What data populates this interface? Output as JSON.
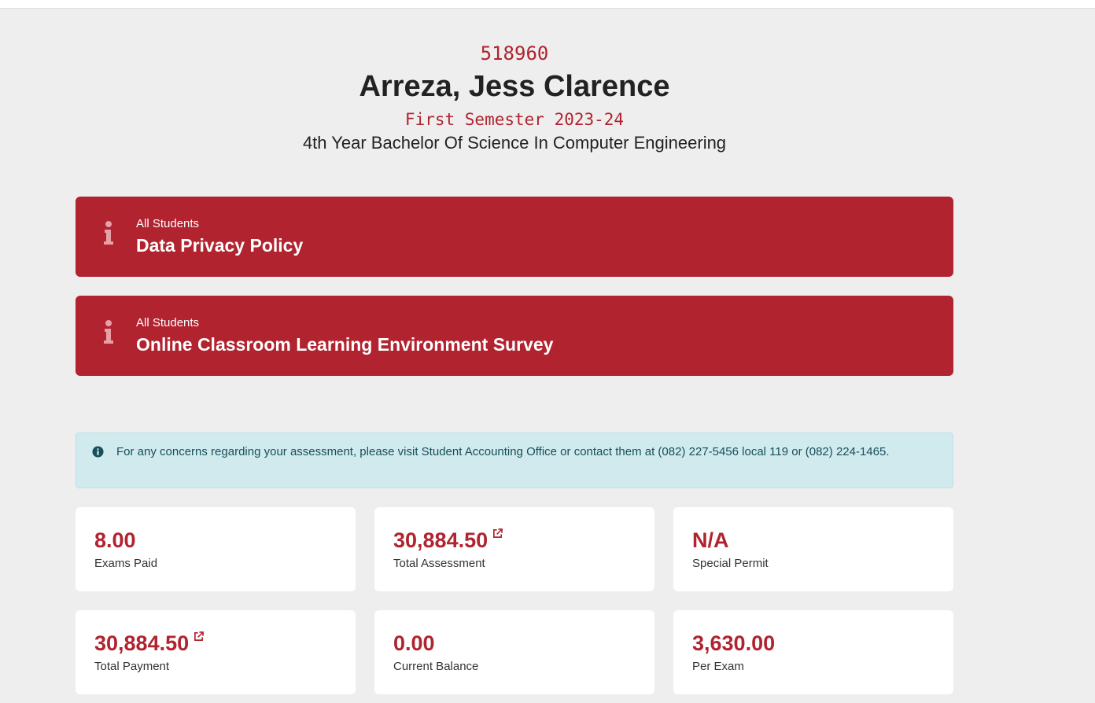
{
  "student": {
    "id": "518960",
    "name": "Arreza, Jess Clarence",
    "semester": "First Semester 2023-24",
    "program": "4th Year Bachelor Of Science In Computer Engineering"
  },
  "announcements": [
    {
      "audience": "All Students",
      "title": "Data Privacy Policy",
      "icon": "info-icon"
    },
    {
      "audience": "All Students",
      "title": "Online Classroom Learning Environment Survey",
      "icon": "info-icon"
    }
  ],
  "notice": {
    "icon": "info-circle-icon",
    "text": "For any concerns regarding your assessment, please visit Student Accounting Office or contact them at (082) 227-5456 local 119 or (082) 224-1465."
  },
  "stats": [
    {
      "value": "8.00",
      "label": "Exams Paid"
    },
    {
      "value": "30,884.50",
      "label": "Total Assessment",
      "icon": "external-link-icon"
    },
    {
      "value": "N/A",
      "label": "Special Permit"
    },
    {
      "value": "30,884.50",
      "label": "Total Payment",
      "icon": "external-link-icon"
    },
    {
      "value": "0.00",
      "label": "Current Balance"
    },
    {
      "value": "3,630.00",
      "label": "Per Exam"
    }
  ],
  "colors": {
    "accent": "#b0232f",
    "background": "#eeeeee",
    "notice_bg": "#d1eaee",
    "notice_text": "#174f5a"
  }
}
